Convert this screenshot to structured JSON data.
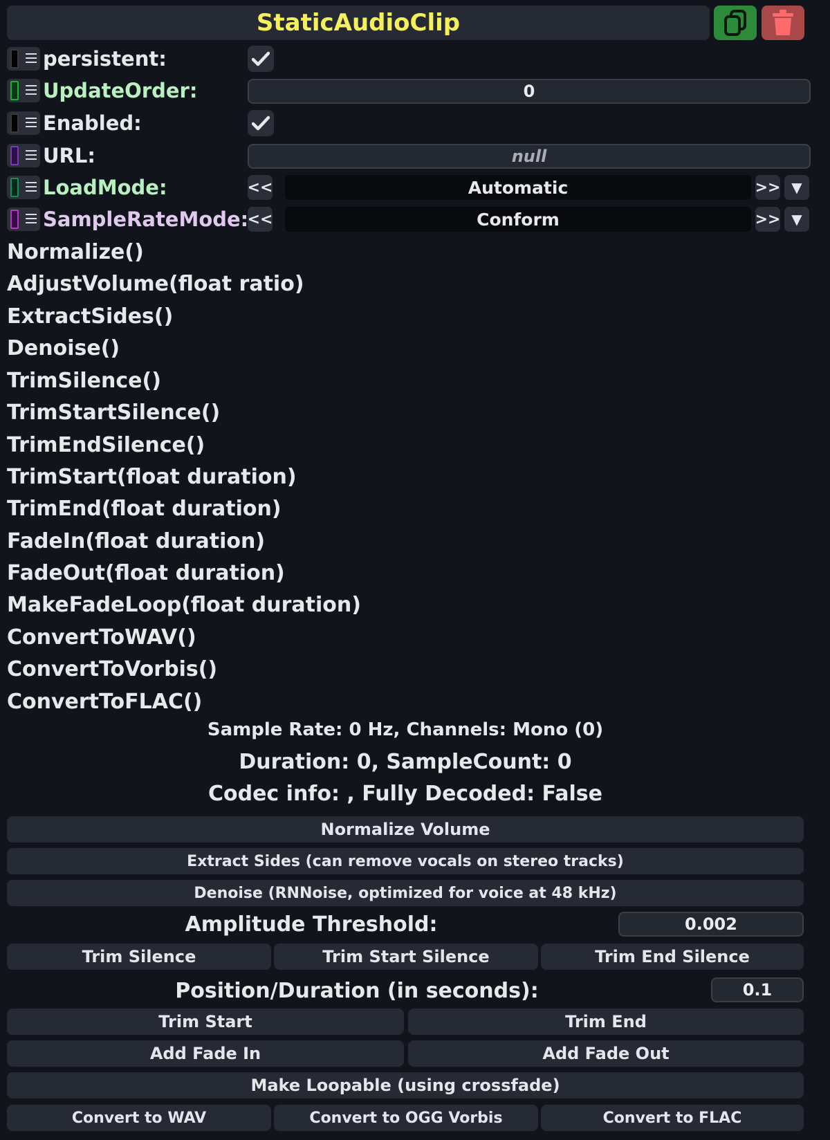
{
  "header": {
    "title": "StaticAudioClip",
    "title_color": "#f5f05a"
  },
  "properties": [
    {
      "label": "persistent:",
      "type": "checkbox",
      "checked": true,
      "swatch": "#000000",
      "color": "#e6e8ec"
    },
    {
      "label": "UpdateOrder:",
      "type": "number",
      "value": "0",
      "swatch": "#1fae3a",
      "color": "#b9f0c0"
    },
    {
      "label": "Enabled:",
      "type": "checkbox",
      "checked": true,
      "swatch": "#000000",
      "color": "#e6e8ec"
    },
    {
      "label": "URL:",
      "type": "text",
      "value": "null",
      "swatch": "#5b2a86",
      "color": "#e6e8ec"
    },
    {
      "label": "LoadMode:",
      "type": "enum",
      "value": "Automatic",
      "swatch": "#0d5d3a",
      "color": "#b9f0c0"
    },
    {
      "label": "SampleRateMode:",
      "type": "enum",
      "value": "Conform",
      "swatch": "#6a1f7a",
      "color": "#e0c8ee"
    }
  ],
  "enum_controls": {
    "prev": "<<",
    "next": ">>",
    "dropdown": "▼"
  },
  "methods": [
    "Normalize()",
    "AdjustVolume(float ratio)",
    "ExtractSides()",
    "Denoise()",
    "TrimSilence()",
    "TrimStartSilence()",
    "TrimEndSilence()",
    "TrimStart(float duration)",
    "TrimEnd(float duration)",
    "FadeIn(float duration)",
    "FadeOut(float duration)",
    "MakeFadeLoop(float duration)",
    "ConvertToWAV()",
    "ConvertToVorbis()",
    "ConvertToFLAC()"
  ],
  "info": {
    "line1": "Sample Rate: 0 Hz, Channels: Mono (0)",
    "line2": "Duration: 0, SampleCount: 0",
    "line3": "Codec info: , Fully Decoded: False"
  },
  "actions": {
    "normalize_volume": "Normalize Volume",
    "extract_sides": "Extract Sides (can remove vocals on stereo tracks)",
    "denoise": "Denoise (RNNoise, optimized for voice at 48 kHz)",
    "amplitude_label": "Amplitude Threshold:",
    "amplitude_value": "0.002",
    "trim_silence": "Trim Silence",
    "trim_start_silence": "Trim Start Silence",
    "trim_end_silence": "Trim End Silence",
    "position_label": "Position/Duration (in seconds):",
    "position_value": "0.1",
    "trim_start": "Trim Start",
    "trim_end": "Trim End",
    "add_fade_in": "Add Fade In",
    "add_fade_out": "Add Fade Out",
    "make_loopable": "Make Loopable (using crossfade)",
    "convert_wav": "Convert to WAV",
    "convert_ogg": "Convert to OGG Vorbis",
    "convert_flac": "Convert to FLAC"
  }
}
